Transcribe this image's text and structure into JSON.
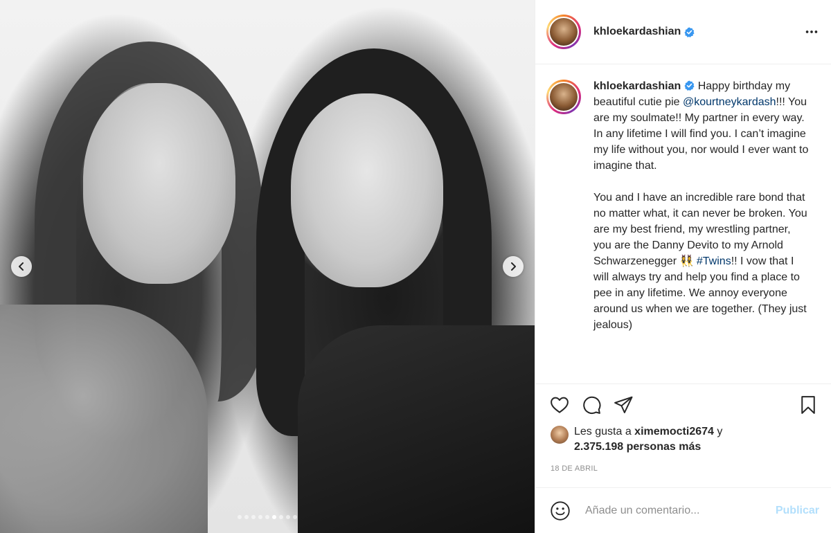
{
  "post": {
    "username": "khloekardashian",
    "verified": true,
    "carousel": {
      "total_slides": 9,
      "active_index": 5
    }
  },
  "caption": {
    "username": "khloekardashian",
    "text_before_mention": " Happy birthday my beautiful cutie pie ",
    "mention": "@kourtneykardash",
    "text_after_mention": "!!! You are my soulmate!! My partner in every way. In any lifetime I will find you. I can’t imagine my life without you, nor would I ever want to imagine that.\n\nYou and I have an incredible rare bond that no matter what, it can never be broken. You are my best friend, my wrestling partner, you are the Danny Devito to my Arnold Schwarzenegger 👯‍♀️ ",
    "hashtag": "#Twins",
    "text_after_hashtag": "!! I vow that I will always try and help you find a place to pee in any lifetime. We annoy everyone around us when we are together. (They just jealous)"
  },
  "likes": {
    "prefix": "Les gusta a ",
    "first_user": "ximemocti2674",
    "middle": " y",
    "count_text": "2.375.198 personas más"
  },
  "date": "18 DE ABRIL",
  "comment_box": {
    "placeholder": "Añade un comentario...",
    "publish_label": "Publicar"
  },
  "colors": {
    "link": "#00376b",
    "verified": "#3897f0",
    "publish_disabled": "#b2dffc",
    "secondary_text": "#8e8e8e"
  },
  "icons": {
    "header_more": "more-horizontal-icon",
    "like": "heart-icon",
    "comment": "comment-bubble-icon",
    "share": "paper-plane-icon",
    "save": "bookmark-icon",
    "emoji": "smiley-icon",
    "prev": "chevron-left-icon",
    "next": "chevron-right-icon"
  }
}
